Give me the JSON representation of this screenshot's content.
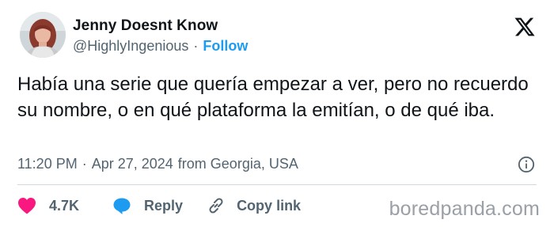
{
  "author": {
    "display_name": "Jenny Doesnt Know",
    "handle": "@HighlyIngenious",
    "separator": "·",
    "follow_label": "Follow",
    "avatar_icon": "profile-photo"
  },
  "tweet": {
    "text": "Había una serie que quería empezar a ver, pero no recuerdo su nombre, o en qué plataforma la emitían, o de qué iba.",
    "time": "11:20 PM",
    "meta_separator": "·",
    "date": "Apr 27, 2024",
    "location": "from Georgia, USA"
  },
  "actions": {
    "likes": "4.7K",
    "reply_label": "Reply",
    "copy_link_label": "Copy link"
  },
  "watermark": "boredpanda.com",
  "colors": {
    "text": "#0f1419",
    "secondary": "#536471",
    "accent": "#1d9bf0",
    "like": "#f91880",
    "divider": "#cfd9de"
  },
  "icons": [
    "x-logo-icon",
    "info-icon",
    "heart-icon",
    "reply-bubble-icon",
    "link-icon"
  ]
}
